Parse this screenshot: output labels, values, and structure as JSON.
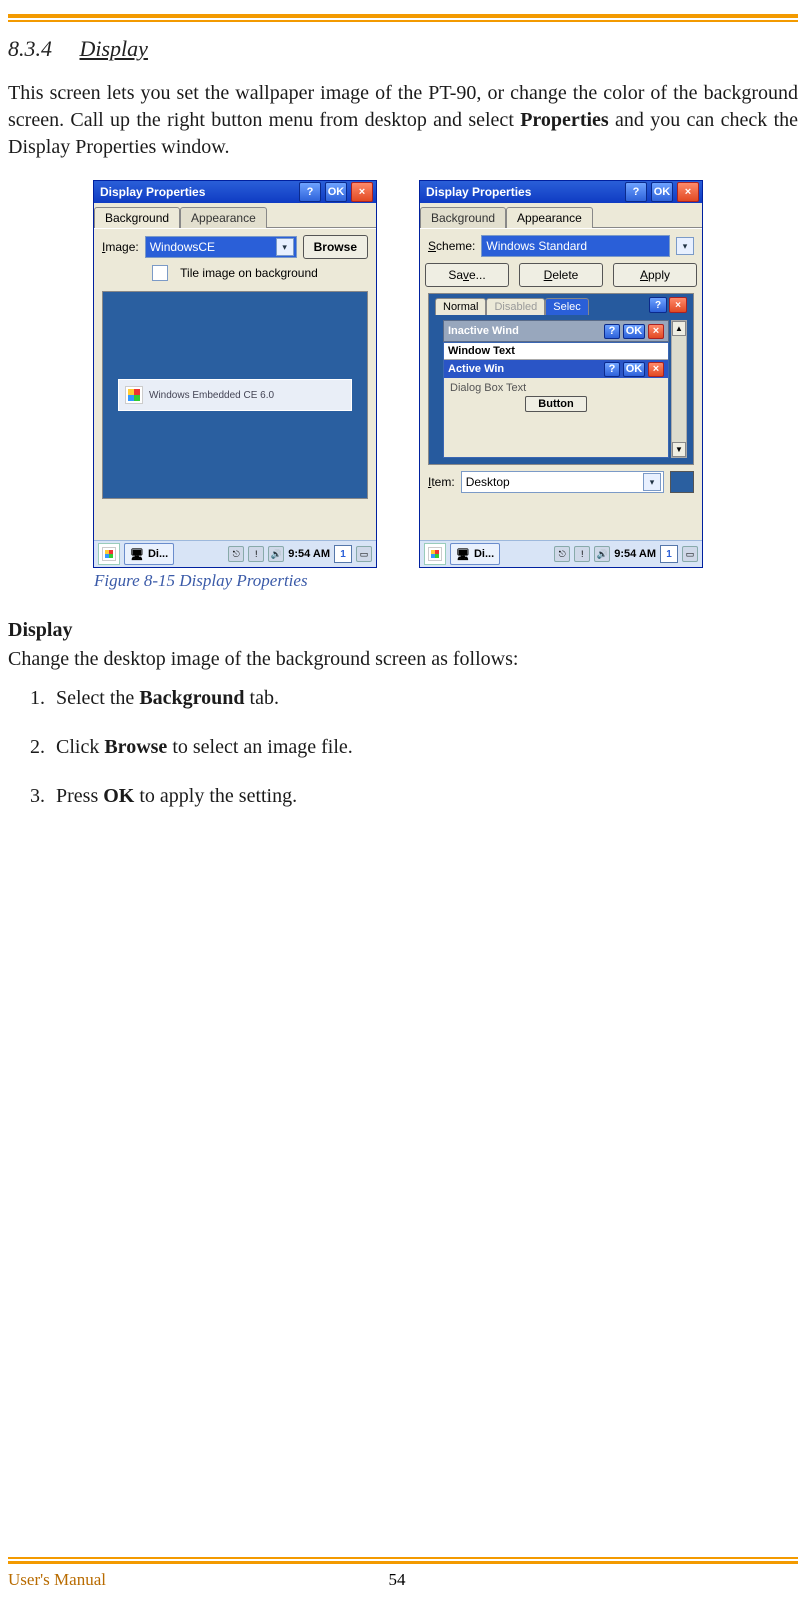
{
  "section": {
    "number": "8.3.4",
    "title": "Display"
  },
  "intro": {
    "t1": "This screen lets you set the wallpaper image of the PT-90, or change the color of the background screen. Call up the right button menu from desktop and select ",
    "bold1": "Properties",
    "t2": " and you can check the Display Properties window."
  },
  "caption": "Figure 8-15 Display Properties",
  "win": {
    "title": "Display Properties",
    "help": "?",
    "ok": "OK",
    "close": "×",
    "tabs": {
      "background": "Background",
      "appearance": "Appearance"
    },
    "bg": {
      "imageLabelU": "I",
      "imageLabel": "mage:",
      "imageValue": "WindowsCE",
      "browse": "Browse",
      "tile": "Tile image on background",
      "banner": "Windows Embedded CE 6.0"
    },
    "ap": {
      "schemeLabelU": "S",
      "schemeLabel": "cheme:",
      "schemeValue": "Windows Standard",
      "save": "Save...",
      "saveU": "v",
      "delete": "Delete",
      "apply": "Apply",
      "tabNormal": "Normal",
      "tabDisabled": "Disabled",
      "tabSelected": "Selec",
      "inactive": "Inactive Wind",
      "windowText": "Window Text",
      "active": "Active Win",
      "dialog": "Dialog Box Text",
      "button": "Button",
      "itemLabelU": "I",
      "itemLabel": "tem:",
      "itemValue": "Desktop"
    },
    "taskbar": {
      "task": "Di...",
      "time": "9:54 AM",
      "kbd": "1"
    }
  },
  "sub": {
    "heading": "Display",
    "lead": "Change the desktop image of the background screen as follows:"
  },
  "steps": {
    "s1a": "Select the ",
    "s1b": "Background",
    "s1c": " tab.",
    "s2a": "Click ",
    "s2b": "Browse",
    "s2c": " to select an image file.",
    "s3a": "Press ",
    "s3b": "OK",
    "s3c": " to apply the setting."
  },
  "footer": {
    "left": "User's Manual",
    "page": "54"
  }
}
